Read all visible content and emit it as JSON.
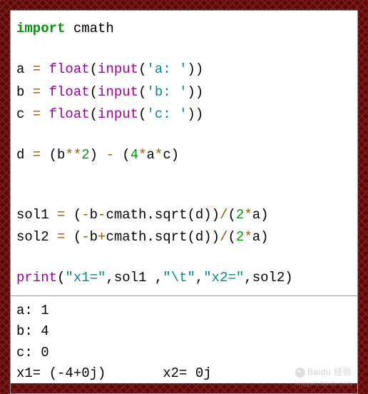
{
  "code": {
    "l1_kw": "import",
    "l1_mod": " cmath",
    "l3_var": "a ",
    "l3_eq": "= ",
    "l3_fn1": "float",
    "l3_p1": "(",
    "l3_fn2": "input",
    "l3_p2": "(",
    "l3_str": "'a: '",
    "l3_p3": "))",
    "l4_var": "b ",
    "l4_eq": "= ",
    "l4_fn1": "float",
    "l4_p1": "(",
    "l4_fn2": "input",
    "l4_p2": "(",
    "l4_str": "'b: '",
    "l4_p3": "))",
    "l5_var": "c ",
    "l5_eq": "= ",
    "l5_fn1": "float",
    "l5_p1": "(",
    "l5_fn2": "input",
    "l5_p2": "(",
    "l5_str": "'c: '",
    "l5_p3": "))",
    "l7_a": "d ",
    "l7_eq": "=",
    "l7_b": " (b",
    "l7_pow": "**",
    "l7_n2": "2",
    "l7_c": ") ",
    "l7_minus": "-",
    "l7_d": " (",
    "l7_n4": "4",
    "l7_mul1": "*",
    "l7_e": "a",
    "l7_mul2": "*",
    "l7_f": "c)",
    "l10_a": "sol1 ",
    "l10_eq": "=",
    "l10_b": " (",
    "l10_neg": "-",
    "l10_c": "b",
    "l10_minus": "-",
    "l10_d": "cmath.sqrt(d))",
    "l10_div": "/",
    "l10_e": "(",
    "l10_n2": "2",
    "l10_mul": "*",
    "l10_f": "a)",
    "l11_a": "sol2 ",
    "l11_eq": "=",
    "l11_b": " (",
    "l11_neg": "-",
    "l11_c": "b",
    "l11_plus": "+",
    "l11_d": "cmath.sqrt(d))",
    "l11_div": "/",
    "l11_e": "(",
    "l11_n2": "2",
    "l11_mul": "*",
    "l11_f": "a)",
    "l13_fn": "print",
    "l13_p1": "(",
    "l13_s1": "\"x1=\"",
    "l13_c1": ",sol1 ,",
    "l13_s2": "\"\\t\"",
    "l13_c2": ",",
    "l13_s3": "\"x2=\"",
    "l13_c3": ",sol2)"
  },
  "output": {
    "l1": "a: 1",
    "l2": "b: 4",
    "l3": "c: 0",
    "l4": "x1= (-4+0j)       x2= 0j"
  },
  "watermark": {
    "brand": "Baidu 经验",
    "url": "jingyan.baidu.com"
  }
}
